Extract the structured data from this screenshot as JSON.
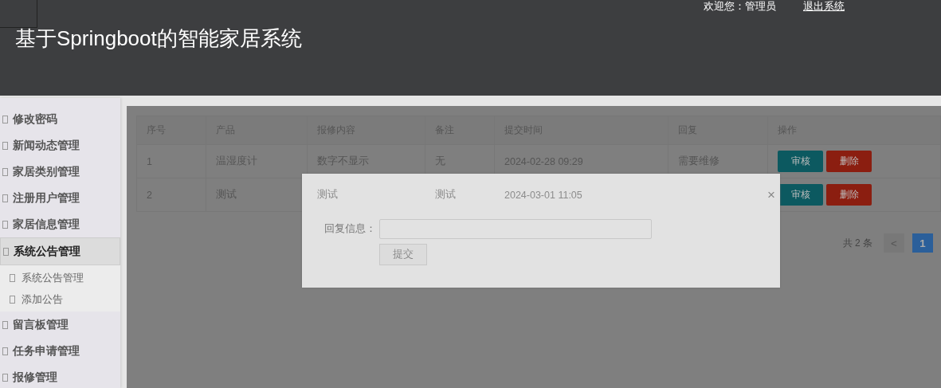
{
  "header": {
    "title": "基于Springboot的智能家居系统",
    "welcome": "欢迎您：管理员",
    "logout": "退出系统"
  },
  "sidebar": {
    "items": [
      {
        "label": "修改密码",
        "selected": false
      },
      {
        "label": "新闻动态管理",
        "selected": false
      },
      {
        "label": "家居类别管理",
        "selected": false
      },
      {
        "label": "注册用户管理",
        "selected": false
      },
      {
        "label": "家居信息管理",
        "selected": false
      },
      {
        "label": "系统公告管理",
        "selected": true,
        "children": [
          {
            "label": "系统公告管理"
          },
          {
            "label": "添加公告"
          }
        ]
      },
      {
        "label": "留言板管理",
        "selected": false
      },
      {
        "label": "任务申请管理",
        "selected": false
      },
      {
        "label": "报修管理",
        "selected": false
      }
    ]
  },
  "table": {
    "columns": [
      "序号",
      "产品",
      "报修内容",
      "备注",
      "提交时间",
      "回复",
      "操作"
    ],
    "rows": [
      {
        "cells": [
          "1",
          "温湿度计",
          "数字不显示",
          "无",
          "2024-02-28 09:29",
          "需要维修"
        ],
        "actions": [
          "审核",
          "删除"
        ]
      },
      {
        "cells": [
          "2",
          "测试",
          "测试",
          "测试",
          "2024-03-01 11:05",
          ""
        ],
        "actions": [
          "审核",
          "删除"
        ]
      }
    ]
  },
  "pagination": {
    "total": "共 2 条",
    "prev": "<",
    "pages": [
      {
        "label": "1",
        "selected": true
      }
    ]
  },
  "dialog": {
    "close": "×",
    "label": "回复信息：",
    "submit": "提交"
  }
}
